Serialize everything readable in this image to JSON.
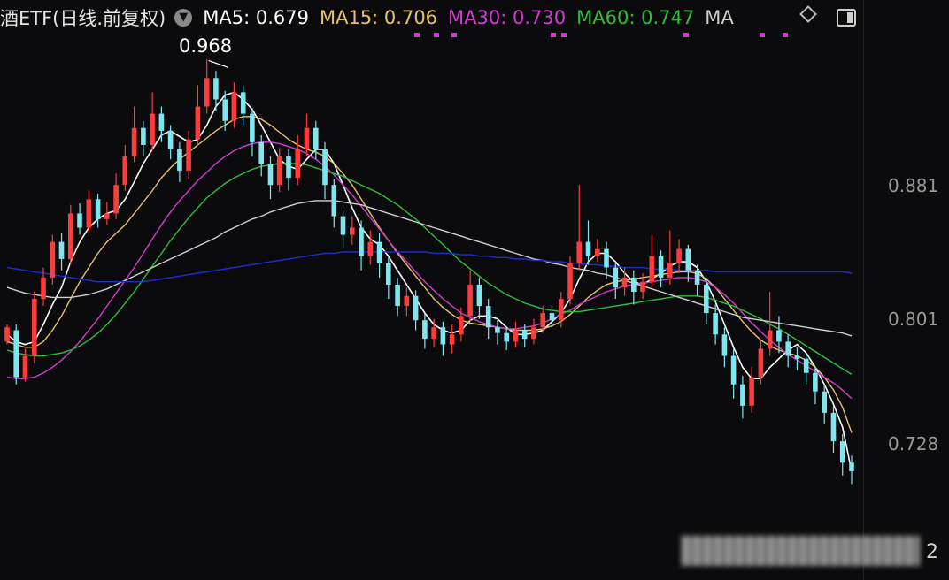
{
  "header": {
    "title": "酒ETF(日线.前复权)",
    "ma5": {
      "label": "MA5: 0.679",
      "color": "#ffffff"
    },
    "ma15": {
      "label": "MA15: 0.706",
      "color": "#e8c26a"
    },
    "ma30": {
      "label": "MA30: 0.730",
      "color": "#d23cd2"
    },
    "ma60": {
      "label": "MA60: 0.747",
      "color": "#2fbf3a"
    },
    "ma_more": {
      "label": "MA",
      "color": "#cfcfcf"
    }
  },
  "peak_label": "0.968",
  "corner_text": "2",
  "chart_data": {
    "type": "candlestick",
    "y_ticks": [
      0.881,
      0.801,
      0.728
    ],
    "ylim": [
      0.62,
      0.985
    ],
    "peak_value": 0.968,
    "up_color": "#ff3b3b",
    "down_color": "#7fe6ef",
    "candles": [
      [
        0.77,
        0.78,
        0.782,
        0.768
      ],
      [
        0.778,
        0.745,
        0.782,
        0.74
      ],
      [
        0.745,
        0.76,
        0.765,
        0.742
      ],
      [
        0.76,
        0.8,
        0.805,
        0.755
      ],
      [
        0.8,
        0.815,
        0.822,
        0.795
      ],
      [
        0.815,
        0.84,
        0.845,
        0.81
      ],
      [
        0.84,
        0.828,
        0.846,
        0.82
      ],
      [
        0.828,
        0.86,
        0.866,
        0.824
      ],
      [
        0.86,
        0.85,
        0.867,
        0.845
      ],
      [
        0.85,
        0.87,
        0.876,
        0.846
      ],
      [
        0.87,
        0.856,
        0.874,
        0.85
      ],
      [
        0.856,
        0.86,
        0.868,
        0.852
      ],
      [
        0.86,
        0.88,
        0.888,
        0.856
      ],
      [
        0.88,
        0.9,
        0.908,
        0.876
      ],
      [
        0.9,
        0.92,
        0.935,
        0.896
      ],
      [
        0.92,
        0.908,
        0.925,
        0.9
      ],
      [
        0.908,
        0.93,
        0.945,
        0.904
      ],
      [
        0.93,
        0.918,
        0.935,
        0.91
      ],
      [
        0.918,
        0.905,
        0.922,
        0.898
      ],
      [
        0.905,
        0.89,
        0.91,
        0.882
      ],
      [
        0.89,
        0.912,
        0.918,
        0.884
      ],
      [
        0.912,
        0.935,
        0.95,
        0.908
      ],
      [
        0.935,
        0.955,
        0.968,
        0.93
      ],
      [
        0.955,
        0.94,
        0.96,
        0.932
      ],
      [
        0.94,
        0.925,
        0.946,
        0.918
      ],
      [
        0.925,
        0.945,
        0.952,
        0.92
      ],
      [
        0.945,
        0.93,
        0.95,
        0.922
      ],
      [
        0.93,
        0.91,
        0.934,
        0.9
      ],
      [
        0.91,
        0.895,
        0.915,
        0.886
      ],
      [
        0.895,
        0.88,
        0.9,
        0.87
      ],
      [
        0.88,
        0.9,
        0.906,
        0.875
      ],
      [
        0.9,
        0.885,
        0.905,
        0.876
      ],
      [
        0.885,
        0.905,
        0.915,
        0.88
      ],
      [
        0.905,
        0.92,
        0.93,
        0.9
      ],
      [
        0.92,
        0.905,
        0.925,
        0.898
      ],
      [
        0.905,
        0.88,
        0.91,
        0.87
      ],
      [
        0.88,
        0.858,
        0.884,
        0.85
      ],
      [
        0.858,
        0.845,
        0.862,
        0.836
      ],
      [
        0.845,
        0.85,
        0.858,
        0.838
      ],
      [
        0.85,
        0.83,
        0.855,
        0.82
      ],
      [
        0.83,
        0.84,
        0.848,
        0.824
      ],
      [
        0.84,
        0.825,
        0.846,
        0.815
      ],
      [
        0.825,
        0.81,
        0.83,
        0.8
      ],
      [
        0.81,
        0.795,
        0.815,
        0.788
      ],
      [
        0.795,
        0.802,
        0.808,
        0.788
      ],
      [
        0.802,
        0.785,
        0.806,
        0.778
      ],
      [
        0.785,
        0.772,
        0.79,
        0.765
      ],
      [
        0.772,
        0.78,
        0.786,
        0.766
      ],
      [
        0.78,
        0.768,
        0.784,
        0.76
      ],
      [
        0.768,
        0.775,
        0.782,
        0.762
      ],
      [
        0.775,
        0.788,
        0.794,
        0.77
      ],
      [
        0.788,
        0.81,
        0.82,
        0.784
      ],
      [
        0.81,
        0.795,
        0.815,
        0.786
      ],
      [
        0.795,
        0.78,
        0.8,
        0.772
      ],
      [
        0.78,
        0.776,
        0.785,
        0.768
      ],
      [
        0.776,
        0.77,
        0.78,
        0.764
      ],
      [
        0.77,
        0.778,
        0.784,
        0.766
      ],
      [
        0.778,
        0.772,
        0.782,
        0.766
      ],
      [
        0.772,
        0.78,
        0.786,
        0.768
      ],
      [
        0.78,
        0.79,
        0.795,
        0.776
      ],
      [
        0.79,
        0.785,
        0.796,
        0.78
      ],
      [
        0.785,
        0.8,
        0.805,
        0.78
      ],
      [
        0.8,
        0.825,
        0.83,
        0.796
      ],
      [
        0.825,
        0.84,
        0.88,
        0.82
      ],
      [
        0.84,
        0.83,
        0.855,
        0.824
      ],
      [
        0.83,
        0.835,
        0.842,
        0.826
      ],
      [
        0.835,
        0.822,
        0.84,
        0.814
      ],
      [
        0.822,
        0.808,
        0.826,
        0.8
      ],
      [
        0.808,
        0.815,
        0.822,
        0.802
      ],
      [
        0.815,
        0.805,
        0.82,
        0.796
      ],
      [
        0.805,
        0.812,
        0.818,
        0.8
      ],
      [
        0.812,
        0.83,
        0.845,
        0.808
      ],
      [
        0.83,
        0.815,
        0.834,
        0.808
      ],
      [
        0.815,
        0.825,
        0.848,
        0.81
      ],
      [
        0.825,
        0.835,
        0.842,
        0.818
      ],
      [
        0.835,
        0.82,
        0.838,
        0.812
      ],
      [
        0.82,
        0.81,
        0.824,
        0.802
      ],
      [
        0.81,
        0.79,
        0.815,
        0.782
      ],
      [
        0.79,
        0.775,
        0.796,
        0.768
      ],
      [
        0.775,
        0.76,
        0.78,
        0.752
      ],
      [
        0.76,
        0.74,
        0.765,
        0.73
      ],
      [
        0.74,
        0.725,
        0.746,
        0.716
      ],
      [
        0.725,
        0.745,
        0.752,
        0.72
      ],
      [
        0.745,
        0.765,
        0.772,
        0.74
      ],
      [
        0.765,
        0.778,
        0.805,
        0.76
      ],
      [
        0.778,
        0.77,
        0.788,
        0.762
      ],
      [
        0.77,
        0.76,
        0.775,
        0.752
      ],
      [
        0.76,
        0.758,
        0.766,
        0.75
      ],
      [
        0.758,
        0.748,
        0.762,
        0.74
      ],
      [
        0.748,
        0.735,
        0.752,
        0.726
      ],
      [
        0.735,
        0.72,
        0.74,
        0.712
      ],
      [
        0.72,
        0.7,
        0.725,
        0.692
      ],
      [
        0.7,
        0.685,
        0.705,
        0.676
      ],
      [
        0.685,
        0.679,
        0.69,
        0.67
      ]
    ],
    "ma_lines": [
      {
        "key": "ma5",
        "color": "#ffffff",
        "values": [
          0.775,
          0.77,
          0.768,
          0.77,
          0.782,
          0.796,
          0.808,
          0.826,
          0.84,
          0.85,
          0.856,
          0.86,
          0.862,
          0.87,
          0.882,
          0.895,
          0.905,
          0.915,
          0.918,
          0.914,
          0.91,
          0.912,
          0.922,
          0.935,
          0.943,
          0.945,
          0.94,
          0.933,
          0.922,
          0.91,
          0.898,
          0.893,
          0.891,
          0.898,
          0.905,
          0.905,
          0.895,
          0.88,
          0.864,
          0.85,
          0.842,
          0.838,
          0.83,
          0.82,
          0.81,
          0.8,
          0.79,
          0.782,
          0.778,
          0.776,
          0.778,
          0.785,
          0.788,
          0.788,
          0.786,
          0.78,
          0.775,
          0.775,
          0.776,
          0.778,
          0.784,
          0.79,
          0.8,
          0.814,
          0.826,
          0.832,
          0.832,
          0.826,
          0.818,
          0.812,
          0.81,
          0.814,
          0.818,
          0.823,
          0.826,
          0.826,
          0.822,
          0.812,
          0.798,
          0.782,
          0.766,
          0.752,
          0.744,
          0.744,
          0.752,
          0.758,
          0.764,
          0.768,
          0.762,
          0.752,
          0.74,
          0.726,
          0.71,
          0.679
        ]
      },
      {
        "key": "ma15",
        "color": "#e8c26a",
        "values": [
          0.77,
          0.768,
          0.766,
          0.766,
          0.77,
          0.778,
          0.788,
          0.8,
          0.812,
          0.822,
          0.832,
          0.84,
          0.846,
          0.852,
          0.86,
          0.868,
          0.876,
          0.885,
          0.892,
          0.898,
          0.903,
          0.908,
          0.913,
          0.918,
          0.922,
          0.926,
          0.928,
          0.928,
          0.926,
          0.922,
          0.917,
          0.912,
          0.908,
          0.905,
          0.903,
          0.9,
          0.895,
          0.888,
          0.88,
          0.87,
          0.86,
          0.85,
          0.841,
          0.832,
          0.824,
          0.816,
          0.808,
          0.8,
          0.794,
          0.789,
          0.785,
          0.783,
          0.782,
          0.781,
          0.78,
          0.779,
          0.778,
          0.778,
          0.778,
          0.779,
          0.781,
          0.784,
          0.789,
          0.795,
          0.801,
          0.806,
          0.81,
          0.812,
          0.813,
          0.814,
          0.815,
          0.816,
          0.817,
          0.818,
          0.819,
          0.819,
          0.818,
          0.814,
          0.808,
          0.8,
          0.792,
          0.784,
          0.777,
          0.771,
          0.767,
          0.764,
          0.762,
          0.76,
          0.757,
          0.752,
          0.745,
          0.736,
          0.724,
          0.706
        ]
      },
      {
        "key": "ma30",
        "color": "#d23cd2",
        "values": [
          0.745,
          0.744,
          0.744,
          0.745,
          0.748,
          0.752,
          0.757,
          0.763,
          0.77,
          0.778,
          0.786,
          0.795,
          0.804,
          0.813,
          0.822,
          0.832,
          0.842,
          0.852,
          0.861,
          0.869,
          0.876,
          0.883,
          0.889,
          0.895,
          0.9,
          0.904,
          0.907,
          0.909,
          0.91,
          0.91,
          0.909,
          0.907,
          0.905,
          0.902,
          0.898,
          0.893,
          0.887,
          0.88,
          0.873,
          0.865,
          0.857,
          0.849,
          0.841,
          0.833,
          0.826,
          0.819,
          0.812,
          0.806,
          0.8,
          0.795,
          0.79,
          0.787,
          0.784,
          0.782,
          0.78,
          0.779,
          0.779,
          0.78,
          0.781,
          0.783,
          0.786,
          0.789,
          0.792,
          0.796,
          0.799,
          0.802,
          0.805,
          0.807,
          0.809,
          0.81,
          0.811,
          0.812,
          0.813,
          0.814,
          0.815,
          0.815,
          0.814,
          0.812,
          0.808,
          0.803,
          0.797,
          0.79,
          0.783,
          0.777,
          0.771,
          0.766,
          0.761,
          0.757,
          0.753,
          0.749,
          0.745,
          0.741,
          0.736,
          0.73
        ]
      },
      {
        "key": "ma60",
        "color": "#2fbf3a",
        "values": [
          0.764,
          0.762,
          0.761,
          0.76,
          0.76,
          0.761,
          0.762,
          0.764,
          0.767,
          0.771,
          0.776,
          0.782,
          0.789,
          0.797,
          0.805,
          0.814,
          0.823,
          0.832,
          0.841,
          0.849,
          0.857,
          0.864,
          0.871,
          0.876,
          0.881,
          0.885,
          0.888,
          0.891,
          0.893,
          0.894,
          0.895,
          0.895,
          0.895,
          0.894,
          0.892,
          0.89,
          0.888,
          0.886,
          0.883,
          0.88,
          0.877,
          0.874,
          0.87,
          0.866,
          0.861,
          0.856,
          0.85,
          0.844,
          0.838,
          0.832,
          0.826,
          0.821,
          0.816,
          0.811,
          0.807,
          0.803,
          0.8,
          0.797,
          0.795,
          0.793,
          0.792,
          0.791,
          0.791,
          0.791,
          0.792,
          0.793,
          0.794,
          0.795,
          0.796,
          0.797,
          0.798,
          0.799,
          0.8,
          0.801,
          0.802,
          0.802,
          0.802,
          0.801,
          0.799,
          0.797,
          0.795,
          0.792,
          0.789,
          0.786,
          0.782,
          0.779,
          0.775,
          0.771,
          0.767,
          0.763,
          0.759,
          0.755,
          0.751,
          0.747
        ]
      },
      {
        "key": "ma120",
        "color": "#cfcfcf",
        "values": [
          0.808,
          0.806,
          0.804,
          0.803,
          0.802,
          0.801,
          0.801,
          0.801,
          0.802,
          0.803,
          0.805,
          0.807,
          0.81,
          0.813,
          0.816,
          0.819,
          0.822,
          0.825,
          0.828,
          0.831,
          0.834,
          0.837,
          0.84,
          0.843,
          0.847,
          0.85,
          0.853,
          0.856,
          0.858,
          0.861,
          0.863,
          0.865,
          0.867,
          0.868,
          0.869,
          0.869,
          0.869,
          0.868,
          0.867,
          0.866,
          0.864,
          0.862,
          0.86,
          0.858,
          0.856,
          0.854,
          0.852,
          0.85,
          0.848,
          0.846,
          0.844,
          0.842,
          0.84,
          0.838,
          0.836,
          0.834,
          0.832,
          0.83,
          0.828,
          0.827,
          0.825,
          0.824,
          0.822,
          0.821,
          0.82,
          0.818,
          0.817,
          0.815,
          0.813,
          0.811,
          0.809,
          0.807,
          0.805,
          0.803,
          0.801,
          0.799,
          0.797,
          0.795,
          0.793,
          0.791,
          0.789,
          0.787,
          0.786,
          0.785,
          0.784,
          0.783,
          0.782,
          0.781,
          0.78,
          0.779,
          0.778,
          0.777,
          0.776,
          0.774
        ]
      },
      {
        "key": "ma250",
        "color": "#1c2fd6",
        "values": [
          0.822,
          0.821,
          0.82,
          0.819,
          0.818,
          0.817,
          0.816,
          0.815,
          0.814,
          0.813,
          0.812,
          0.812,
          0.812,
          0.812,
          0.812,
          0.812,
          0.813,
          0.814,
          0.815,
          0.816,
          0.817,
          0.818,
          0.819,
          0.82,
          0.821,
          0.822,
          0.823,
          0.824,
          0.825,
          0.826,
          0.827,
          0.828,
          0.829,
          0.83,
          0.831,
          0.832,
          0.832,
          0.833,
          0.833,
          0.833,
          0.833,
          0.833,
          0.833,
          0.833,
          0.833,
          0.833,
          0.833,
          0.832,
          0.832,
          0.832,
          0.831,
          0.831,
          0.83,
          0.83,
          0.829,
          0.829,
          0.828,
          0.828,
          0.827,
          0.827,
          0.826,
          0.826,
          0.825,
          0.825,
          0.824,
          0.824,
          0.823,
          0.823,
          0.822,
          0.822,
          0.822,
          0.821,
          0.821,
          0.821,
          0.82,
          0.82,
          0.82,
          0.82,
          0.819,
          0.819,
          0.819,
          0.819,
          0.819,
          0.819,
          0.819,
          0.819,
          0.819,
          0.819,
          0.819,
          0.819,
          0.819,
          0.819,
          0.819,
          0.818
        ]
      }
    ]
  }
}
